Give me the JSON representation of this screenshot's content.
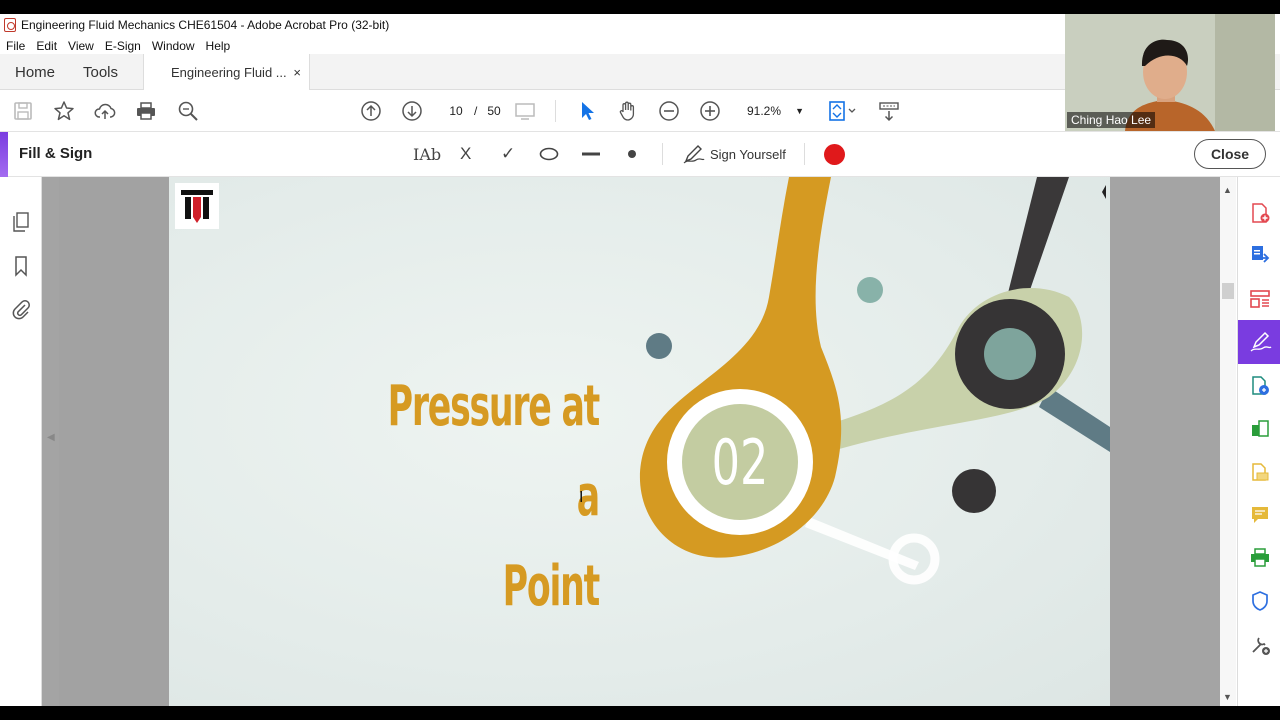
{
  "window": {
    "title": "Engineering Fluid Mechanics  CHE61504 - Adobe Acrobat Pro (32-bit)"
  },
  "menu": [
    "File",
    "Edit",
    "View",
    "E-Sign",
    "Window",
    "Help"
  ],
  "tabs": {
    "home": "Home",
    "tools": "Tools",
    "document": "Engineering Fluid ...",
    "close_glyph": "×"
  },
  "toolbar": {
    "current_page": "10",
    "page_separator": "/",
    "total_pages": "50",
    "zoom": "91.2%"
  },
  "fill_sign": {
    "title": "Fill & Sign",
    "text_tool": "IAb",
    "cross_tool": "X",
    "check_tool": "✓",
    "sign_yourself": "Sign Yourself",
    "close": "Close",
    "accent_color": "#7a3ce0",
    "color_dot": "#e0191b"
  },
  "slide": {
    "title_line1": "Pressure at a",
    "title_line2": "Point",
    "section_number": "02",
    "title_color": "#d69a22"
  },
  "webcam": {
    "participant_name": "Ching Hao Lee"
  },
  "right_tools": [
    "create-pdf-icon",
    "export-pdf-icon",
    "organize-pages-icon",
    "fill-sign-icon",
    "edit-pdf-icon",
    "compress-pdf-icon",
    "scan-icon",
    "comment-icon",
    "print-production-icon",
    "protect-icon",
    "more-tools-icon"
  ]
}
